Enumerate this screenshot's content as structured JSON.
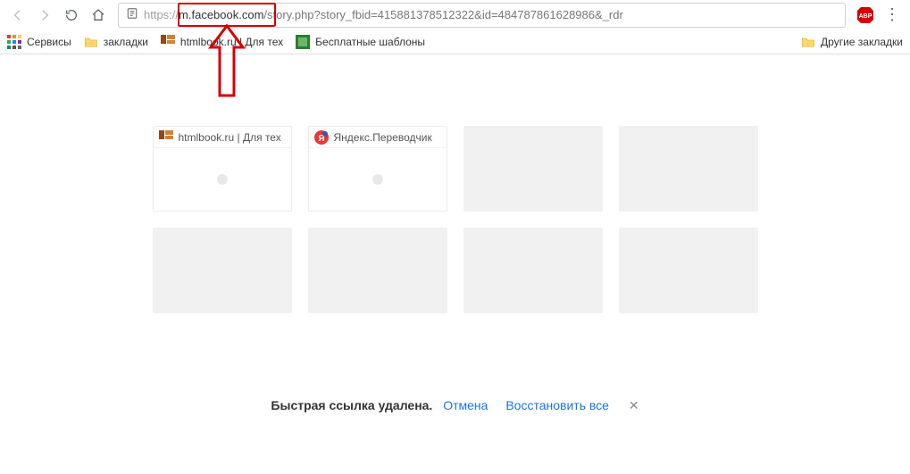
{
  "toolbar": {
    "url_scheme": "https://",
    "url_highlight": "m.facebook.com",
    "url_path": "/story.php?story_fbid=415881378512322&id=484787861628986&_rdr"
  },
  "bookmarks": {
    "apps_label": "Сервисы",
    "items": [
      {
        "label": "закладки",
        "type": "folder"
      },
      {
        "label": "htmlbook.ru | Для тех",
        "type": "hb"
      },
      {
        "label": "Бесплатные шаблоны",
        "type": "green"
      }
    ],
    "other_label": "Другие закладки"
  },
  "tiles": [
    {
      "label": "htmlbook.ru | Для тех",
      "icon": "hb",
      "has_title": true
    },
    {
      "label": "Яндекс.Переводчик",
      "icon": "ya",
      "has_title": true
    },
    {
      "has_title": false
    },
    {
      "has_title": false
    },
    {
      "has_title": false
    },
    {
      "has_title": false
    },
    {
      "has_title": false
    },
    {
      "has_title": false
    }
  ],
  "undo": {
    "msg": "Быстрая ссылка удалена.",
    "cancel": "Отмена",
    "restore": "Восстановить все"
  }
}
